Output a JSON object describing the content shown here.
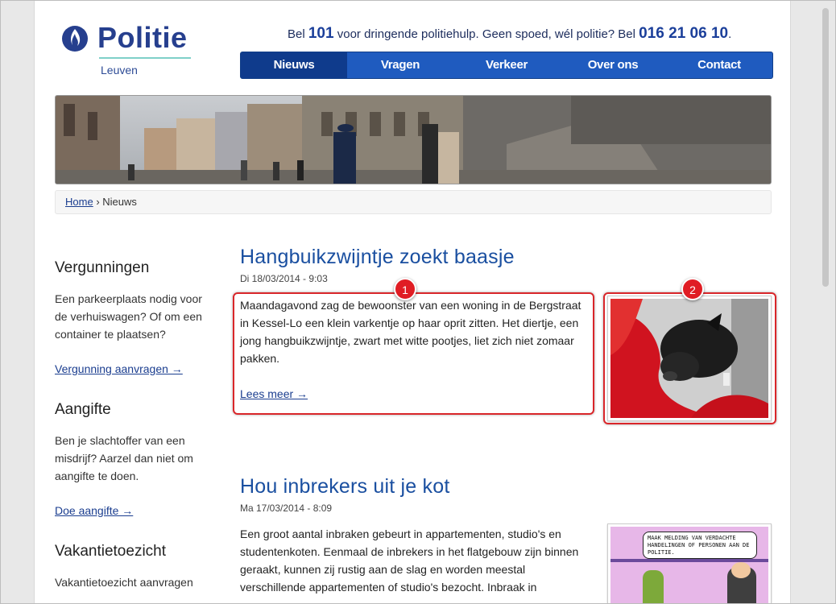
{
  "logo": {
    "name": "Politie",
    "city": "Leuven"
  },
  "callbar": {
    "prefix": "Bel",
    "emergency_number": "101",
    "middle": "voor dringende politiehulp. Geen spoed, wél politie? Bel",
    "local_number": "016 21 06 10",
    "suffix": "."
  },
  "nav": {
    "items": [
      {
        "label": "Nieuws"
      },
      {
        "label": "Vragen"
      },
      {
        "label": "Verkeer"
      },
      {
        "label": "Over ons"
      },
      {
        "label": "Contact"
      }
    ]
  },
  "breadcrumb": {
    "home": "Home",
    "separator": "›",
    "current": "Nieuws"
  },
  "sidebar": {
    "blocks": [
      {
        "title": "Vergunningen",
        "text": "Een parkeerplaats nodig voor de verhuiswagen? Of om een container te plaatsen?",
        "link": "Vergunning aanvragen →"
      },
      {
        "title": "Aangifte",
        "text": "Ben je slachtoffer van een misdrijf? Aarzel dan niet om aangifte te doen.",
        "link": "Doe aangifte →"
      },
      {
        "title": "Vakantietoezicht",
        "text": "Vakantietoezicht aanvragen",
        "link": ""
      }
    ]
  },
  "articles": [
    {
      "title": "Hangbuikzwijntje zoekt baasje",
      "date": "Di 18/03/2014 - 9:03",
      "body": "Maandagavond zag de bewoonster van een woning in de Bergstraat in Kessel-Lo een klein varkentje op haar oprit zitten. Het diertje, een jong hangbuikzwijntje, zwart met witte pootjes, liet zich niet zomaar pakken.",
      "more": "Lees meer →"
    },
    {
      "title": "Hou inbrekers uit je kot",
      "date": "Ma 17/03/2014 - 8:09",
      "body": "Een groot aantal inbraken gebeurt in appartementen, studio's en studentenkoten. Eenmaal de inbrekers in het flatgebouw zijn binnen geraakt, kunnen zij rustig aan de slag en worden meestal verschillende appartementen of studio's bezocht. Inbraak in",
      "comic_text": "MAAK MELDING VAN VERDACHTE HANDELINGEN OF PERSONEN AAN DE POLITIE."
    }
  ],
  "annotations": {
    "marker_1": "1",
    "marker_2": "2"
  },
  "colors": {
    "brand_blue": "#1f5bbf",
    "nav_active": "#0f3b8c",
    "title_blue": "#1a4fa0",
    "highlight_red": "#d9262a"
  }
}
